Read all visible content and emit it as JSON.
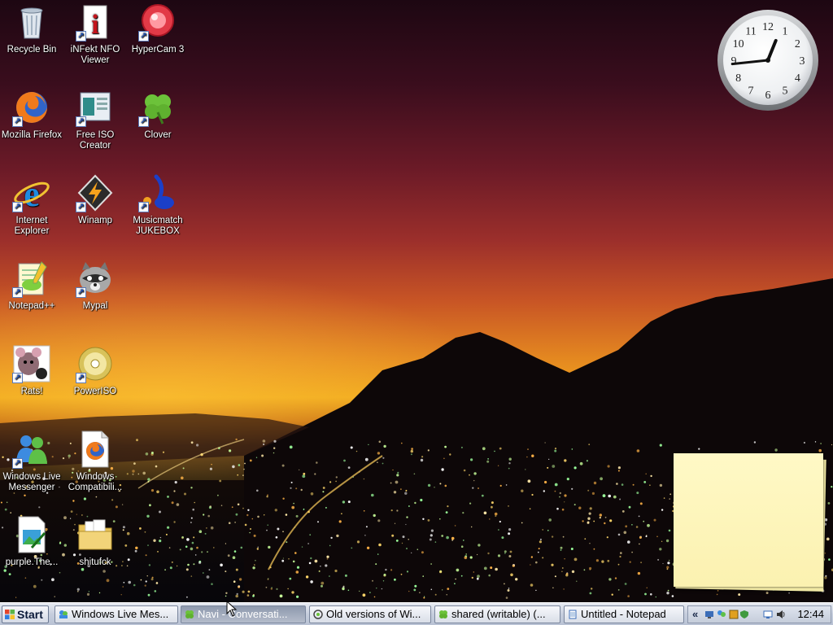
{
  "desktop_icons": [
    {
      "label": "Recycle Bin",
      "icon": "recycle-bin-icon",
      "shortcut": false
    },
    {
      "label": "iNFekt NFO Viewer",
      "icon": "nfo-viewer-icon",
      "shortcut": true
    },
    {
      "label": "HyperCam 3",
      "icon": "hypercam-icon",
      "shortcut": true
    },
    {
      "label": "Mozilla Firefox",
      "icon": "firefox-icon",
      "shortcut": true
    },
    {
      "label": "Free ISO Creator",
      "icon": "iso-creator-icon",
      "shortcut": true
    },
    {
      "label": "Clover",
      "icon": "clover-icon",
      "shortcut": true
    },
    {
      "label": "Internet Explorer",
      "icon": "internet-explorer-icon",
      "shortcut": true
    },
    {
      "label": "Winamp",
      "icon": "winamp-icon",
      "shortcut": true
    },
    {
      "label": "Musicmatch JUKEBOX",
      "icon": "musicmatch-icon",
      "shortcut": true
    },
    {
      "label": "Notepad++",
      "icon": "notepad-plus-plus-icon",
      "shortcut": true
    },
    {
      "label": "Mypal",
      "icon": "mypal-raccoon-icon",
      "shortcut": true
    },
    {
      "label": "Rats!",
      "icon": "rats-icon",
      "shortcut": true
    },
    {
      "label": "PowerISO",
      "icon": "poweriso-disc-icon",
      "shortcut": true
    },
    {
      "label": "Windows Live Messenger",
      "icon": "messenger-icon",
      "shortcut": true
    },
    {
      "label": "Windows Compatibili...",
      "icon": "firefox-document-icon",
      "shortcut": false
    },
    {
      "label": "purple.The...",
      "icon": "image-file-icon",
      "shortcut": false
    },
    {
      "label": "shitufck",
      "icon": "folder-icon",
      "shortcut": false
    }
  ],
  "clock": {
    "numerals": [
      "12",
      "1",
      "2",
      "3",
      "4",
      "5",
      "6",
      "7",
      "8",
      "9",
      "10",
      "11"
    ],
    "hour": 12,
    "minute": 44
  },
  "taskbar": {
    "start_label": "Start",
    "tasks": [
      {
        "label": "Windows Live Mes...",
        "icon": "messenger-icon",
        "active": false
      },
      {
        "label": "Navi - Conversati...",
        "icon": "clover-icon",
        "active": true
      },
      {
        "label": "Old versions of Wi...",
        "icon": "browser-icon",
        "active": false
      },
      {
        "label": "shared (writable) (...",
        "icon": "clover-icon",
        "active": false
      },
      {
        "label": "Untitled - Notepad",
        "icon": "notepad-icon",
        "active": false
      }
    ],
    "tray_expand": "«",
    "tray_icons": [
      "network-icon",
      "messenger-tray-icon",
      "app-tray-icon",
      "shield-icon",
      "display-icon",
      "volume-icon"
    ],
    "time": "12:44"
  },
  "colors": {
    "sticky_note": "#fbf1b0",
    "taskbar": "#c6cedd",
    "active_task": "#8e99ad",
    "sunset_orange": "#f0a81c"
  }
}
